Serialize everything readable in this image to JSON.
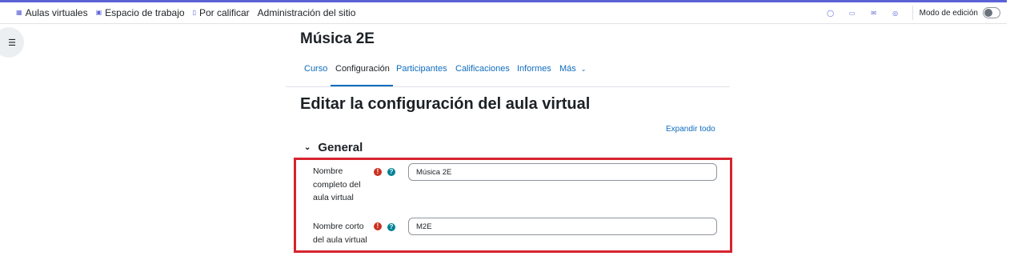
{
  "navbar": {
    "items": [
      {
        "label": "Aulas virtuales",
        "icon": "grid-icon"
      },
      {
        "label": "Espacio de trabajo",
        "icon": "dashboard-icon"
      },
      {
        "label": "Por calificar",
        "icon": "document-icon"
      },
      {
        "label": "Administración del sitio"
      }
    ],
    "tools": [
      "bell-icon",
      "chat-icon",
      "mail-icon",
      "settings-icon"
    ],
    "edit_mode_label": "Modo de edición",
    "edit_mode_on": false
  },
  "course": {
    "title": "Música 2E"
  },
  "tabs": [
    {
      "label": "Curso"
    },
    {
      "label": "Configuración",
      "active": true
    },
    {
      "label": "Participantes"
    },
    {
      "label": "Calificaciones"
    },
    {
      "label": "Informes"
    },
    {
      "label": "Más"
    }
  ],
  "page": {
    "heading": "Editar la configuración del aula virtual",
    "expand_all": "Expandir todo"
  },
  "section": {
    "title": "General"
  },
  "fields": {
    "fullname": {
      "label_lines": [
        "Nombre",
        "completo del",
        "aula virtual"
      ],
      "value": "Música 2E"
    },
    "shortname": {
      "label_lines": [
        "Nombre corto",
        "del aula virtual"
      ],
      "value": "M2E"
    }
  },
  "colors": {
    "accent": "#5b62d6",
    "link": "#0f6cbf",
    "required": "#ca3120",
    "help": "#008196",
    "highlight": "#d6242e"
  }
}
